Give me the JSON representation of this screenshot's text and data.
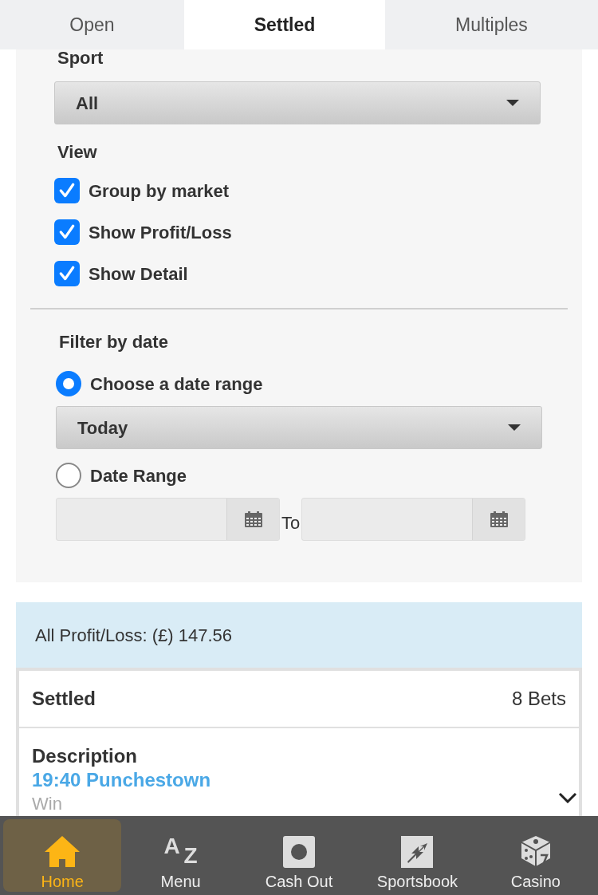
{
  "tabs": [
    {
      "label": "Open",
      "selected": false
    },
    {
      "label": "Settled",
      "selected": true
    },
    {
      "label": "Multiples",
      "selected": false
    }
  ],
  "sport": {
    "label": "Sport",
    "value": "All"
  },
  "view": {
    "label": "View",
    "options": [
      {
        "label": "Group by market",
        "checked": true
      },
      {
        "label": "Show Profit/Loss",
        "checked": true
      },
      {
        "label": "Show Detail",
        "checked": true
      }
    ]
  },
  "filter": {
    "label": "Filter by date",
    "options": [
      {
        "label": "Choose a date range",
        "selected": true
      },
      {
        "label": "Date Range",
        "selected": false
      }
    ],
    "range_value": "Today",
    "to_label": "To"
  },
  "profit_loss": "All Profit/Loss: (£) 147.56",
  "bets": {
    "title": "Settled",
    "count": "8 Bets",
    "description_label": "Description",
    "event": "19:40 Punchestown",
    "market": "Win"
  },
  "nav": [
    {
      "kind": "home",
      "label": "Home",
      "selected": true
    },
    {
      "kind": "az",
      "label": "Menu",
      "selected": false,
      "glyphs": [
        "A",
        "Z"
      ]
    },
    {
      "kind": "cashout",
      "label": "Cash Out",
      "selected": false
    },
    {
      "kind": "sportsbook",
      "label": "Sportsbook",
      "selected": false
    },
    {
      "kind": "casino",
      "label": "Casino",
      "selected": false
    }
  ]
}
